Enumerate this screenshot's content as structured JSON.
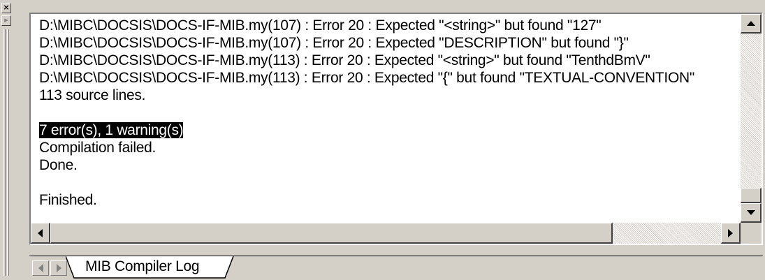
{
  "window": {
    "gripper": {
      "close_glyph": "×",
      "float_glyph": "▸"
    }
  },
  "output": {
    "lines": [
      "D:\\MIBC\\DOCSIS\\DOCS-IF-MIB.my(107) : Error 20 : Expected \"<string>\" but found \"127\"",
      "D:\\MIBC\\DOCSIS\\DOCS-IF-MIB.my(107) : Error 20 : Expected \"DESCRIPTION\" but found \"}\"",
      "D:\\MIBC\\DOCSIS\\DOCS-IF-MIB.my(113) : Error 20 : Expected \"<string>\" but found \"TenthdBmV\"",
      "D:\\MIBC\\DOCSIS\\DOCS-IF-MIB.my(113) : Error 20 : Expected \"{\" but found \"TEXTUAL-CONVENTION\"",
      "113 source lines.",
      "",
      "7 error(s), 1 warning(s)",
      "Compilation failed.",
      "Done.",
      "",
      "Finished."
    ],
    "highlighted_line_index": 6
  },
  "tabs": {
    "items": [
      {
        "label": "MIB Compiler Log",
        "active": true
      }
    ]
  },
  "colors": {
    "chrome": "#d4d0c8",
    "text_bg": "#ffffff",
    "highlight_bg": "#000000",
    "highlight_fg": "#ffffff"
  }
}
